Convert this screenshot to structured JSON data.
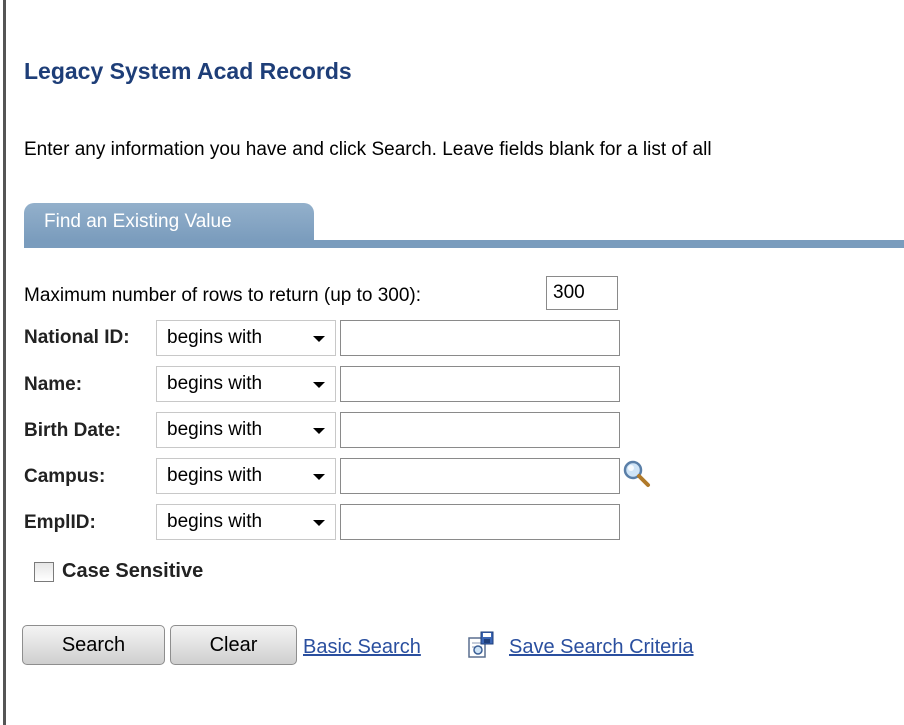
{
  "page": {
    "title": "Legacy System Acad Records",
    "instructions": "Enter any information you have and click Search. Leave fields blank for a list of all"
  },
  "tab": {
    "label": "Find an Existing Value"
  },
  "form": {
    "max_rows_label": "Maximum number of rows to return (up to 300):",
    "max_rows_value": "300",
    "fields": [
      {
        "label": "National ID:",
        "operator": "begins with",
        "value": ""
      },
      {
        "label": "Name:",
        "operator": "begins with",
        "value": ""
      },
      {
        "label": "Birth Date:",
        "operator": "begins with",
        "value": ""
      },
      {
        "label": "Campus:",
        "operator": "begins with",
        "value": ""
      },
      {
        "label": "EmplID:",
        "operator": "begins with",
        "value": ""
      }
    ],
    "case_sensitive_label": "Case Sensitive",
    "case_sensitive_checked": false
  },
  "actions": {
    "search_label": "Search",
    "clear_label": "Clear",
    "basic_search_label": "Basic Search",
    "save_criteria_label": "Save Search Criteria"
  },
  "icons": {
    "lookup": "magnifier-lookup-icon",
    "save": "save-search-criteria-icon"
  },
  "colors": {
    "title": "#1e3e78",
    "tab": "#7a9cbd",
    "link": "#2a4f9f"
  }
}
